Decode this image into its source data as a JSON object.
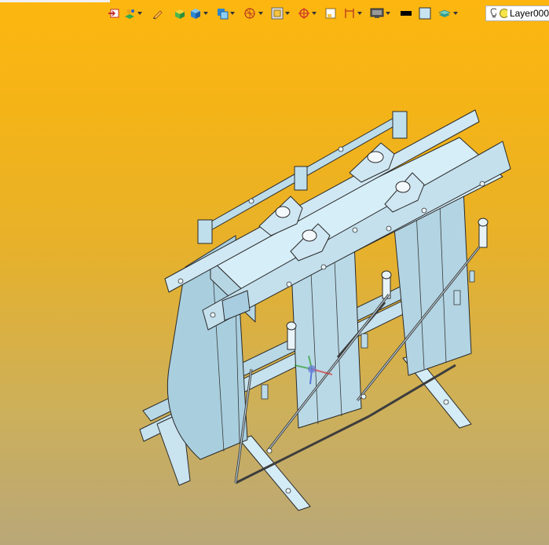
{
  "toolbar": {
    "buttons": [
      {
        "icon": "import-icon",
        "has_menu": false
      },
      {
        "icon": "assembly-icon",
        "has_menu": true
      },
      {
        "icon": "sketch-pencil-icon",
        "has_menu": false
      },
      {
        "icon": "solid-box-icon",
        "has_menu": false
      },
      {
        "icon": "cube-view-icon",
        "has_menu": true
      },
      {
        "icon": "render-mode-icon",
        "has_menu": true
      },
      {
        "icon": "section-view-icon",
        "has_menu": true
      },
      {
        "icon": "zoom-fit-icon",
        "has_menu": true
      },
      {
        "icon": "pan-target-icon",
        "has_menu": true
      },
      {
        "icon": "frame-icon",
        "has_menu": false
      },
      {
        "icon": "dimension-icon",
        "has_menu": true
      },
      {
        "icon": "display-monitor-icon",
        "has_menu": true
      },
      {
        "icon": "line-color-icon",
        "has_menu": false
      },
      {
        "icon": "fill-color-icon",
        "has_menu": false
      },
      {
        "icon": "layers-icon",
        "has_menu": true
      }
    ]
  },
  "layer": {
    "name": "Layer000",
    "light_icon": "lightbulb-icon",
    "status_icon": "layer-status-icon"
  },
  "colors": {
    "background_top": "#fdb60f",
    "background_bottom": "#b9a778",
    "model_face": "#c8e4f0",
    "model_edge": "#2a2a2a"
  }
}
